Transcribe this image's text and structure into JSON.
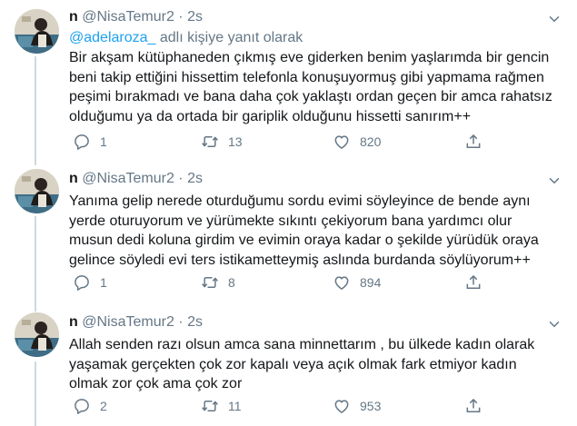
{
  "tweets": [
    {
      "name": "n",
      "handle": "@NisaTemur2",
      "dot": "·",
      "time": "2s",
      "reply_mention": "@adelaroza_",
      "reply_suffix": "adlı kişiye yanıt olarak",
      "text": "Bir akşam kütüphaneden çıkmış eve giderken benim yaşlarımda bir gencin\nbeni takip ettiğini hissettim telefonla konuşuyormuş gibi yapmama rağmen\npeşimi bırakmadı ve bana daha çok yaklaştı ordan geçen bir amca rahatsız\nolduğumu ya da ortada bir gariplik olduğunu hissetti sanırım++",
      "replies": "1",
      "retweets": "13",
      "likes": "820"
    },
    {
      "name": "n",
      "handle": "@NisaTemur2",
      "dot": "·",
      "time": "2s",
      "text": "Yanıma gelip nerede oturduğumu sordu evimi söyleyince de bende aynı\nyerde oturuyorum ve yürümekte sıkıntı çekiyorum bana yardımcı olur\nmusun dedi koluna girdim ve evimin oraya kadar o şekilde yürüdük oraya\ngelince söyledi evi ters istikametteymiş aslında burdanda söylüyorum++",
      "replies": "1",
      "retweets": "8",
      "likes": "894"
    },
    {
      "name": "n",
      "handle": "@NisaTemur2",
      "dot": "·",
      "time": "2s",
      "text": "Allah senden razı olsun amca sana minnettarım , bu ülkede kadın olarak\nyaşamak gerçekten çok zor kapalı veya açık olmak fark etmiyor kadın\nolmak zor çok ama çok zor",
      "replies": "2",
      "retweets": "11",
      "likes": "953"
    }
  ],
  "icons": {
    "reply": "reply-icon",
    "retweet": "retweet-icon",
    "like": "heart-icon",
    "share": "share-icon",
    "menu": "chevron-down-icon"
  },
  "colors": {
    "text": "#14171a",
    "secondary": "#657786",
    "link": "#1da1f2",
    "thread_line": "#cfd9de",
    "divider": "#e6ecf0"
  }
}
